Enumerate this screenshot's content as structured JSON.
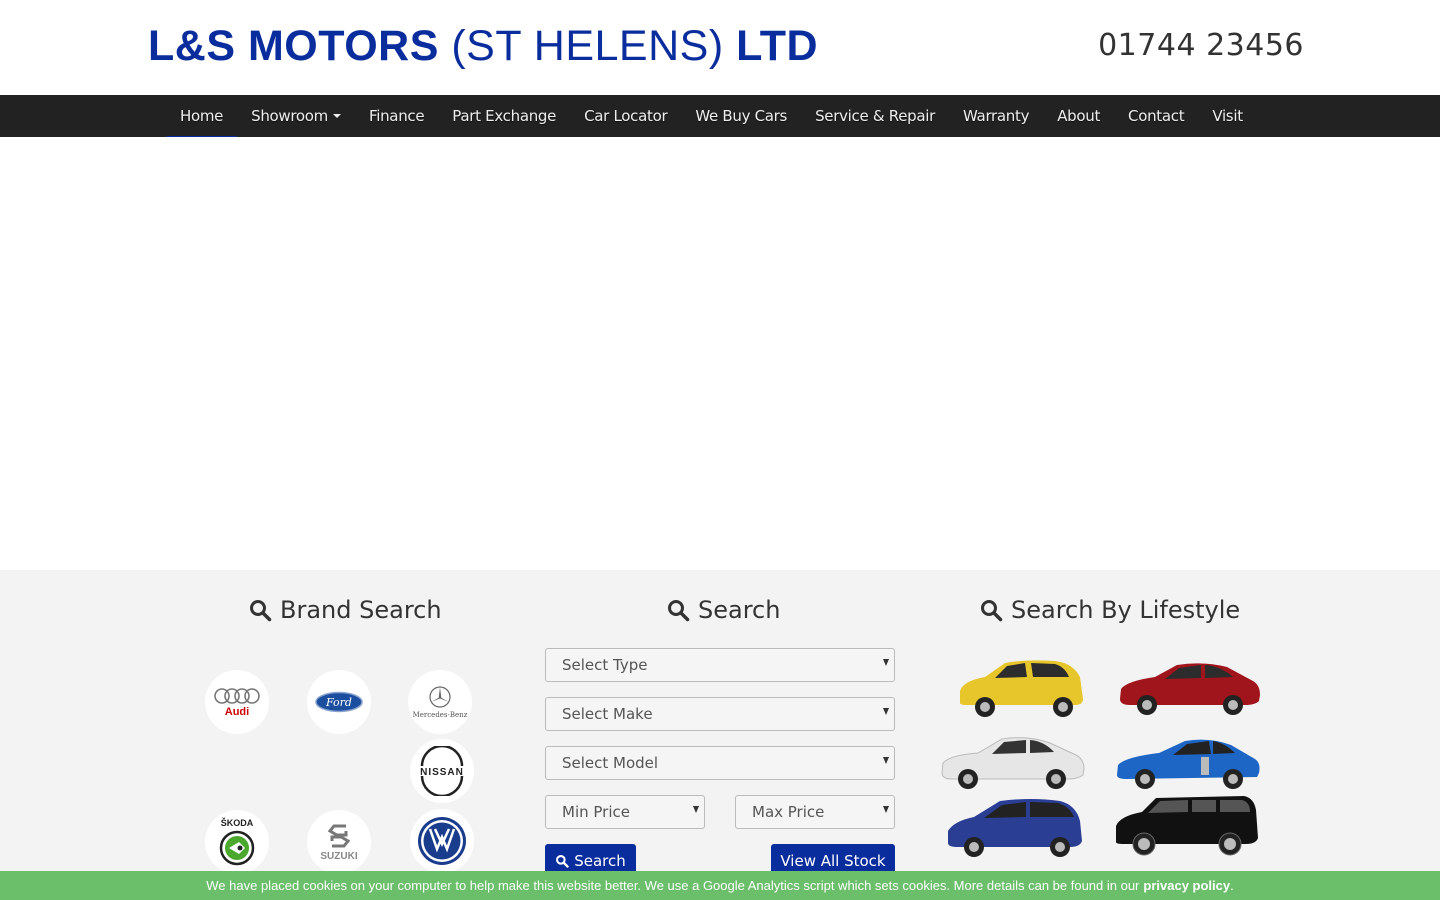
{
  "header": {
    "logo_bold1": "L&S MOTORS",
    "logo_light": "(ST HELENS)",
    "logo_bold2": "LTD",
    "phone": "01744 23456"
  },
  "nav": {
    "items": [
      "Home",
      "Showroom",
      "Finance",
      "Part Exchange",
      "Car Locator",
      "We Buy Cars",
      "Service & Repair",
      "Warranty",
      "About",
      "Contact",
      "Visit"
    ],
    "active": "Home"
  },
  "brand_search": {
    "title": "Brand Search",
    "brands": [
      "Audi",
      "Ford",
      "Mercedes-Benz",
      "Nissan",
      "Skoda",
      "Suzuki",
      "Volkswagen"
    ]
  },
  "search": {
    "title": "Search",
    "select_type": "Select Type",
    "select_make": "Select Make",
    "select_model": "Select Model",
    "min_price": "Min Price",
    "max_price": "Max Price",
    "search_button": "Search",
    "view_all_button": "View All Stock"
  },
  "lifestyle": {
    "title": "Search By Lifestyle",
    "cars": [
      "hatchback-yellow",
      "saloon-red",
      "coupe-silver",
      "sports-blue",
      "mpv-blue",
      "suv-black"
    ]
  },
  "cookie": {
    "text": "We have placed cookies on your computer to help make this website better. We use a Google Analytics script which sets cookies. More details can be found in our",
    "link": "privacy policy",
    "end": "."
  },
  "colors": {
    "brand_blue": "#0a2d9e",
    "nav_bg": "#222222",
    "band_bg": "#f3f3f3",
    "cookie_bg": "#6bbf6b"
  }
}
